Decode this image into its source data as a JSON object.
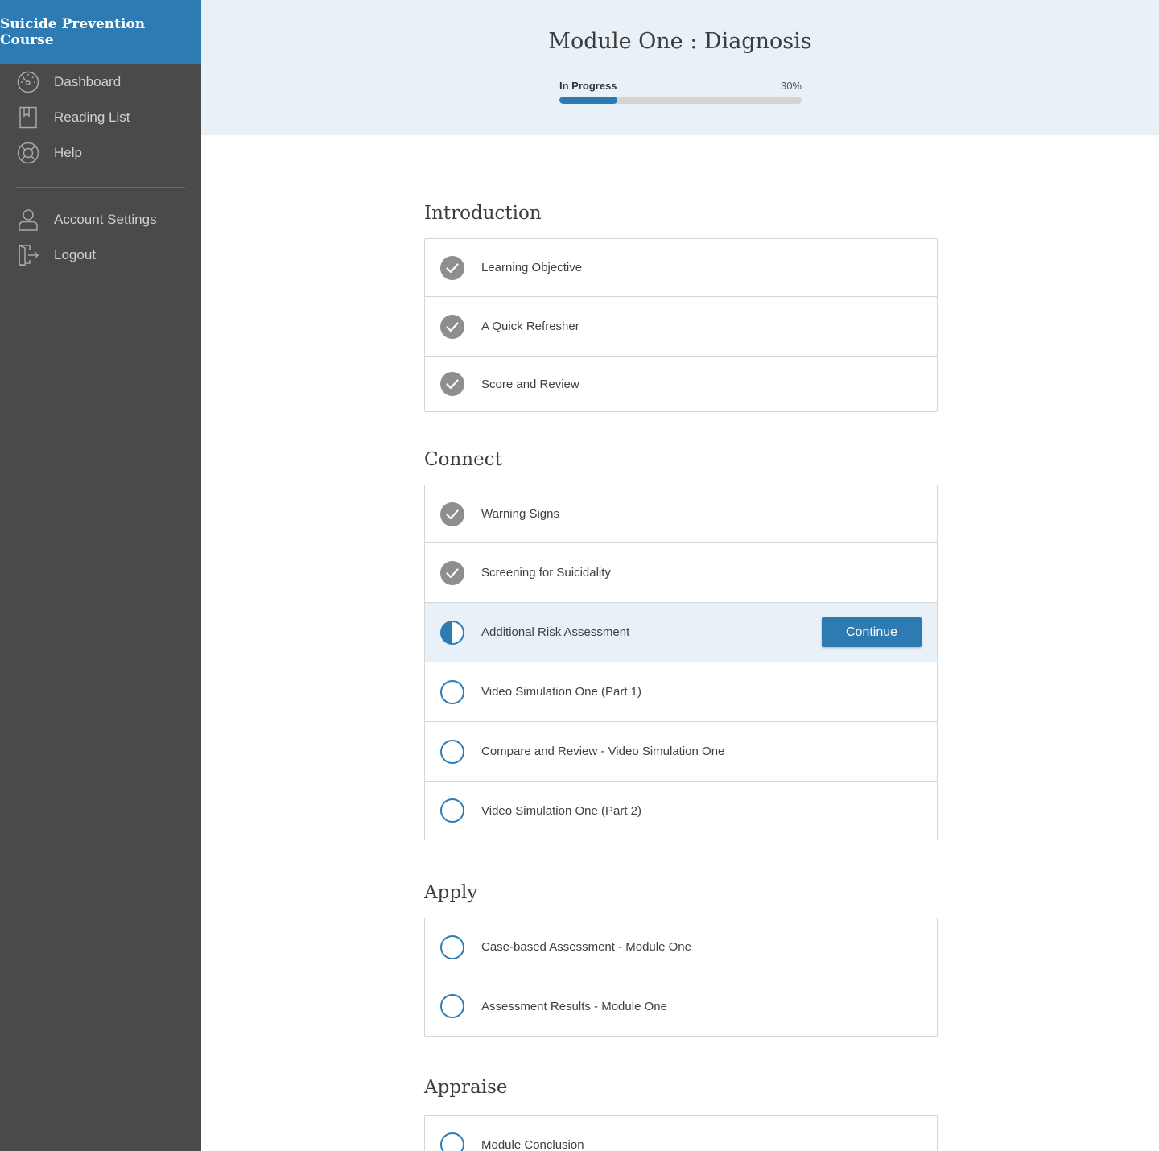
{
  "sidebar": {
    "brand": "Suicide Prevention Course",
    "nav": [
      {
        "label": "Dashboard",
        "icon": "dashboard-icon"
      },
      {
        "label": "Reading List",
        "icon": "bookmark-icon"
      },
      {
        "label": "Help",
        "icon": "lifebuoy-icon"
      }
    ],
    "account_nav": [
      {
        "label": "Account Settings",
        "icon": "user-icon"
      },
      {
        "label": "Logout",
        "icon": "logout-icon"
      }
    ]
  },
  "header": {
    "title": "Module One : Diagnosis",
    "progress": {
      "status": "In Progress",
      "percent_label": "30%",
      "value": 0.24
    }
  },
  "sections": [
    {
      "title": "Introduction",
      "lessons": [
        {
          "label": "Learning Objective",
          "status": "complete"
        },
        {
          "label": "A Quick Refresher",
          "status": "complete"
        },
        {
          "label": "Score and Review",
          "status": "complete"
        }
      ]
    },
    {
      "title": "Connect",
      "lessons": [
        {
          "label": "Warning Signs",
          "status": "complete"
        },
        {
          "label": "Screening for Suicidality",
          "status": "complete"
        },
        {
          "label": "Additional Risk Assessment",
          "status": "in-progress",
          "action": "Continue"
        },
        {
          "label": "Video Simulation One (Part 1)",
          "status": "not-started"
        },
        {
          "label": "Compare and Review - Video Simulation One",
          "status": "not-started"
        },
        {
          "label": "Video Simulation One (Part 2)",
          "status": "not-started"
        }
      ]
    },
    {
      "title": "Apply",
      "lessons": [
        {
          "label": "Case-based Assessment - Module One",
          "status": "not-started"
        },
        {
          "label": "Assessment Results - Module One",
          "status": "not-started"
        }
      ]
    },
    {
      "title": "Appraise",
      "lessons": [
        {
          "label": "Module Conclusion",
          "status": "not-started"
        }
      ]
    }
  ],
  "colors": {
    "accent": "#2e7bb4",
    "sidebar_bg": "#4a4a4a",
    "header_bg": "#e9f1f8",
    "complete_icon": "#8e8e8e"
  }
}
